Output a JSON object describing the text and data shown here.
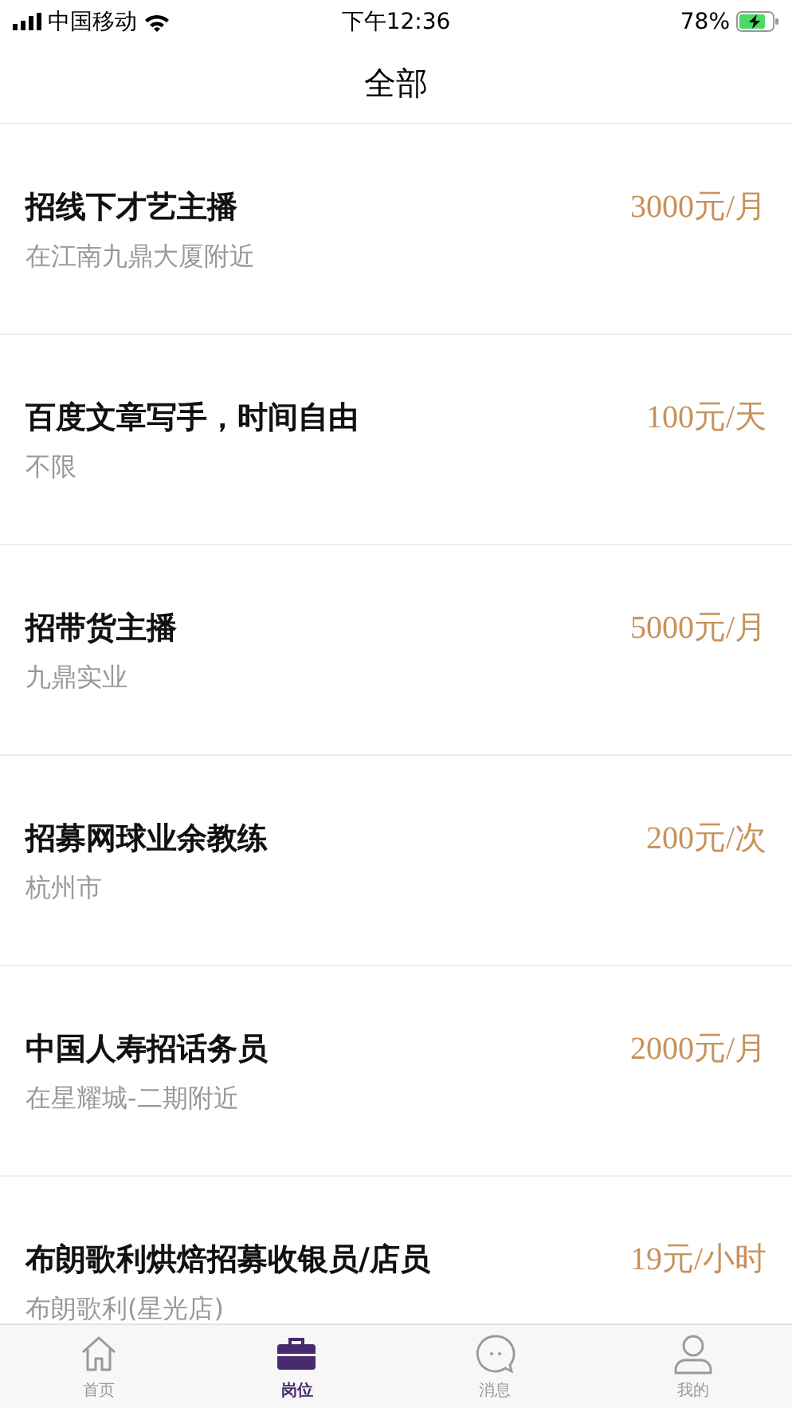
{
  "status_bar": {
    "carrier": "中国移动",
    "time": "下午12:36",
    "battery": "78%"
  },
  "nav": {
    "title": "全部"
  },
  "jobs": [
    {
      "title": "招线下才艺主播",
      "location": "在江南九鼎大厦附近",
      "pay": "3000元/月"
    },
    {
      "title": "百度文章写手，时间自由",
      "location": "不限",
      "pay": "100元/天"
    },
    {
      "title": "招带货主播",
      "location": "九鼎实业",
      "pay": "5000元/月"
    },
    {
      "title": "招募网球业余教练",
      "location": "杭州市",
      "pay": "200元/次"
    },
    {
      "title": "中国人寿招话务员",
      "location": "在星耀城-二期附近",
      "pay": "2000元/月"
    },
    {
      "title": "布朗歌利烘焙招募收银员/店员",
      "location": "布朗歌利(星光店)",
      "pay": "19元/小时"
    }
  ],
  "tab_bar": [
    {
      "kind": "home",
      "label": "首页",
      "selected": false
    },
    {
      "kind": "briefcase",
      "label": "岗位",
      "selected": true
    },
    {
      "kind": "chat",
      "label": "消息",
      "selected": false
    },
    {
      "kind": "person",
      "label": "我的",
      "selected": false
    }
  ]
}
